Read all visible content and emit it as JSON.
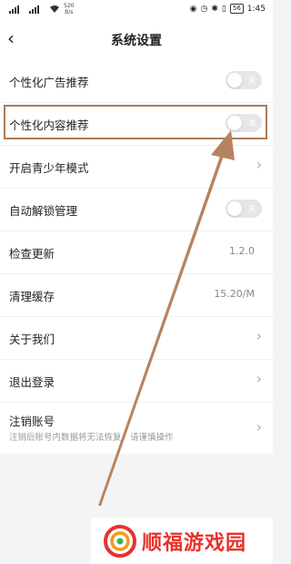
{
  "status_bar": {
    "net_speed_top": "520",
    "net_speed_bottom": "B/s",
    "battery": "56",
    "time": "1:45"
  },
  "header": {
    "title": "系统设置"
  },
  "settings": [
    {
      "label": "个性化广告推荐",
      "type": "toggle",
      "toggle_text": "关"
    },
    {
      "label": "个性化内容推荐",
      "type": "toggle",
      "toggle_text": "关"
    },
    {
      "label": "开启青少年模式",
      "type": "link"
    },
    {
      "label": "自动解锁管理",
      "type": "toggle",
      "toggle_text": "关"
    },
    {
      "label": "检查更新",
      "type": "value",
      "value": "1.2.0"
    },
    {
      "label": "清理缓存",
      "type": "value",
      "value": "15.20/M"
    },
    {
      "label": "关于我们",
      "type": "link"
    },
    {
      "label": "退出登录",
      "type": "link"
    },
    {
      "label": "注销账号",
      "type": "link",
      "sublabel": "注销后账号内数据将无法恢复，请谨慎操作"
    }
  ],
  "watermark": {
    "text": "顺福游戏园"
  },
  "colors": {
    "annotation": "#a97d5a",
    "watermark": "#e8322a"
  }
}
